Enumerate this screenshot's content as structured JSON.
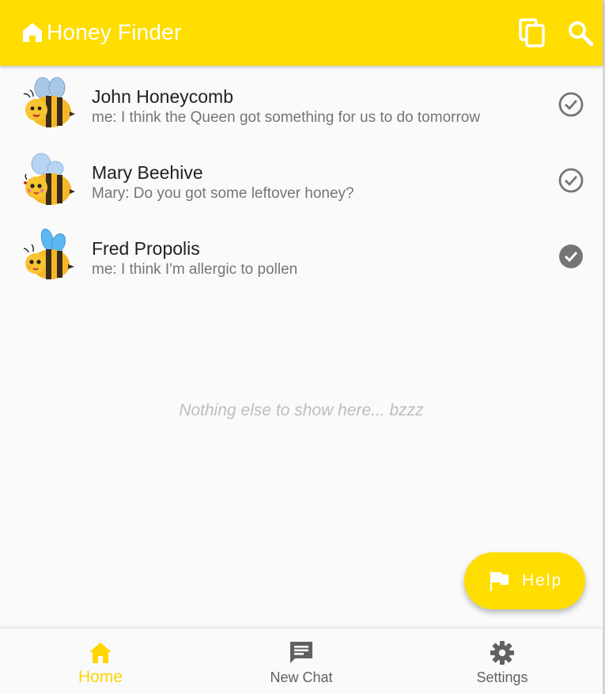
{
  "appbar": {
    "title": "Honey Finder",
    "icons": {
      "home": "home-icon",
      "copy": "copy-icon",
      "search": "search-icon"
    }
  },
  "chats": [
    {
      "name": "John Honeycomb",
      "preview": "me: I think the Queen got something for us to do tomorrow",
      "status": "read-outline"
    },
    {
      "name": "Mary Beehive",
      "preview": "Mary: Do you got some leftover honey?",
      "status": "read-outline"
    },
    {
      "name": "Fred Propolis",
      "preview": "me: I think I'm allergic to pollen",
      "status": "read-filled"
    }
  ],
  "empty_message": "Nothing else to show here... bzzz",
  "fab": {
    "label": "Help",
    "icon": "flag-icon"
  },
  "bottom_nav": [
    {
      "label": "Home",
      "icon": "home-icon",
      "active": true
    },
    {
      "label": "New Chat",
      "icon": "chat-icon",
      "active": false
    },
    {
      "label": "Settings",
      "icon": "gear-icon",
      "active": false
    }
  ],
  "colors": {
    "primary": "#ffdd00",
    "active_tab": "#ffd600",
    "text_secondary": "#757575",
    "icon_grey": "#616161"
  }
}
